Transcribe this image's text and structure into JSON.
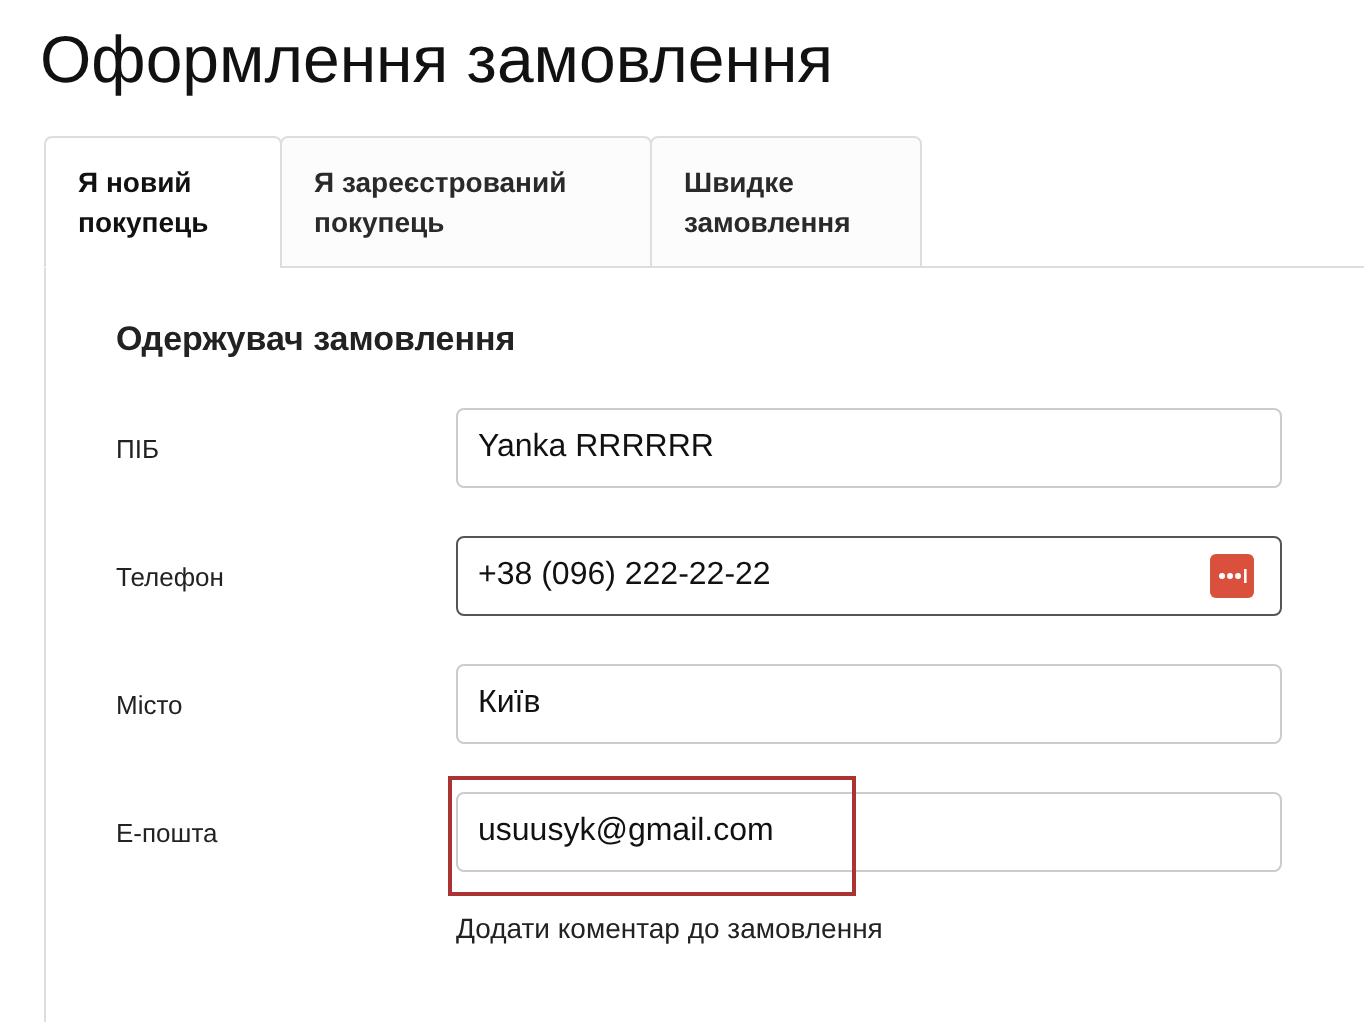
{
  "title": "Оформлення замовлення",
  "tabs": [
    {
      "label": "Я новий покупець",
      "selected": true
    },
    {
      "label": "Я зареєстрований покупець",
      "selected": false
    },
    {
      "label": "Швидке замовлення",
      "selected": false
    }
  ],
  "section_title": "Одержувач замовлення",
  "fields": [
    {
      "label": "ПІБ",
      "value": "Yanka RRRRRR",
      "focused": false,
      "autofill_icon": false,
      "highlighted": false
    },
    {
      "label": "Телефон",
      "value": "+38 (096) 222-22-22",
      "focused": true,
      "autofill_icon": true,
      "highlighted": false
    },
    {
      "label": "Місто",
      "value": "Київ",
      "focused": false,
      "autofill_icon": false,
      "highlighted": false
    },
    {
      "label": "Е-пошта",
      "value": "usuusyk@gmail.com",
      "focused": false,
      "autofill_icon": false,
      "highlighted": true
    }
  ],
  "comment_link": "Додати коментар до замовлення"
}
